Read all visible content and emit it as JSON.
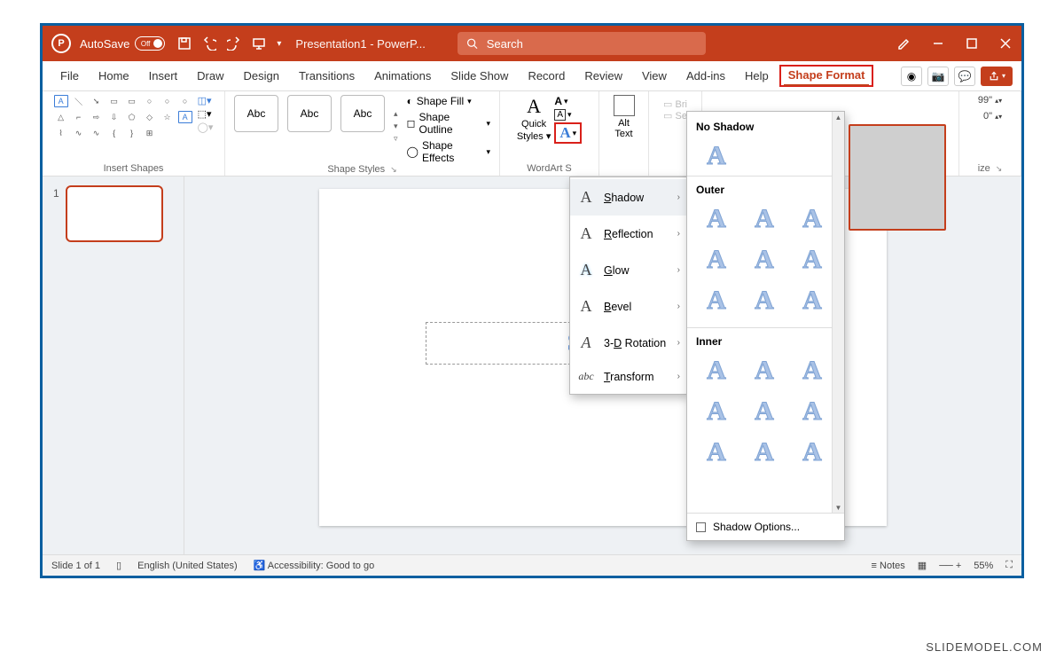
{
  "titlebar": {
    "autosave_label": "AutoSave",
    "autosave_state": "Off",
    "title": "Presentation1 - PowerP...",
    "search_placeholder": "Search"
  },
  "tabs": [
    "File",
    "Home",
    "Insert",
    "Draw",
    "Design",
    "Transitions",
    "Animations",
    "Slide Show",
    "Record",
    "Review",
    "View",
    "Add-ins",
    "Help"
  ],
  "active_tab": "Shape Format",
  "ribbon": {
    "groups": {
      "insert_shapes": "Insert Shapes",
      "shape_styles": "Shape Styles",
      "wordart_styles": "WordArt S",
      "accessibility": "",
      "size": "ize"
    },
    "abc": "Abc",
    "shape_fill": "Shape Fill",
    "shape_outline": "Shape Outline",
    "shape_effects": "Shape Effects",
    "quick_styles": "Quick Styles",
    "alt_text": "Alt Text",
    "bring": "Bri",
    "send": "Se",
    "height_trunc": "99\"",
    "width_trunc": "0\""
  },
  "text_effects_menu": {
    "items": [
      {
        "icon": "A",
        "label": "Shadow",
        "underline": "S"
      },
      {
        "icon": "A",
        "label": "Reflection",
        "underline": "R"
      },
      {
        "icon": "A",
        "label": "Glow",
        "underline": "G"
      },
      {
        "icon": "A",
        "label": "Bevel",
        "underline": "B"
      },
      {
        "icon": "A",
        "label": "3-D Rotation",
        "underline": "D"
      },
      {
        "icon": "abc",
        "label": "Transform",
        "underline": "T"
      }
    ]
  },
  "shadow_gallery": {
    "no_shadow": "No Shadow",
    "outer": "Outer",
    "inner": "Inner",
    "options": "Shadow Options..."
  },
  "slide_text": "Slide I",
  "thumb_num": "1",
  "statusbar": {
    "slide": "Slide 1 of 1",
    "lang": "English (United States)",
    "access": "Accessibility: Good to go",
    "notes": "Notes",
    "zoom": "55%"
  },
  "watermark": "SLIDEMODEL.COM"
}
